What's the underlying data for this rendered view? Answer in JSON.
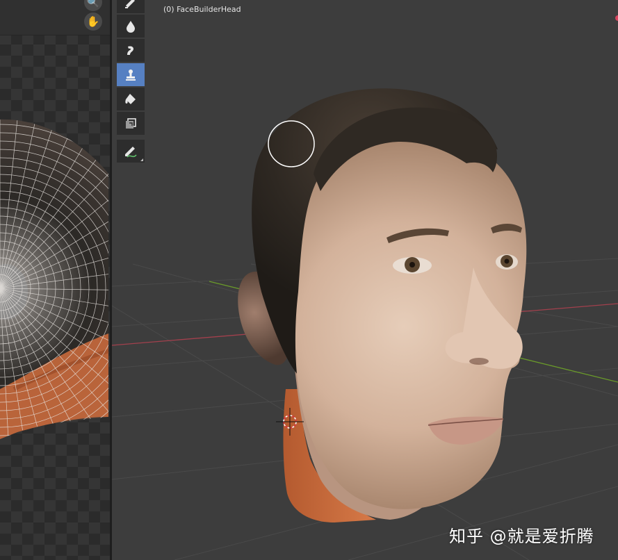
{
  "viewport": {
    "object_label": "(0) FaceBuilderHead"
  },
  "left_panel": {
    "zoom_icon": "magnifier-icon",
    "hand_icon": "hand-icon"
  },
  "toolbar": {
    "tools": [
      {
        "name": "draw-tool",
        "icon": "brush-icon",
        "active": false
      },
      {
        "name": "soften-tool",
        "icon": "drop-icon",
        "active": false
      },
      {
        "name": "smear-tool",
        "icon": "smear-icon",
        "active": false
      },
      {
        "name": "clone-tool",
        "icon": "stamp-icon",
        "active": true
      },
      {
        "name": "fill-tool",
        "icon": "bucket-icon",
        "active": false
      },
      {
        "name": "mask-tool",
        "icon": "mask-icon",
        "active": false
      },
      {
        "name": "annotate-tool",
        "icon": "pencil-line-icon",
        "active": false
      }
    ]
  },
  "colors": {
    "viewport_bg": "#3d3d3d",
    "toolbar_bg": "#2d2d2d",
    "active_tool": "#5680c2",
    "x_axis": "#a3404d",
    "y_axis": "#6a9a2a",
    "skin": "#d9b9a3",
    "hair": "#2e2a25",
    "orange_texture": "#c66a3e"
  },
  "watermark": {
    "text": "知乎 @就是爱折腾"
  }
}
